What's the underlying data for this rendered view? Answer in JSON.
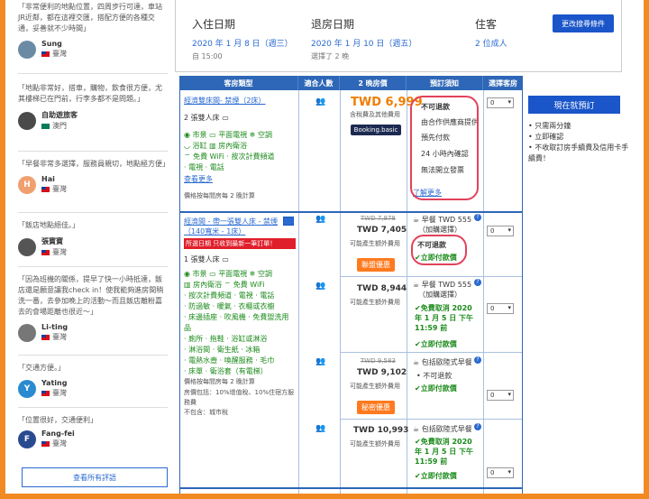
{
  "sidebar": {
    "reviews": [
      {
        "text": "「非常便利的地點位置，四周步行可達，車站JR近鄰，都在這裡交匯，搭配方便的各種交通，妥善就不少時間」",
        "name": "Sung",
        "country": "臺灣",
        "initial": "",
        "color": "#6b8ba4"
      },
      {
        "text": "「地點非常好，搭車，購物，飲食很方便，尤其樓梯已在門前，行李多都不是問題。」",
        "name": "自助遊旅客",
        "country": "澳門",
        "initial": "",
        "color": "#4a4a4a"
      },
      {
        "text": "「早餐非常多選擇，服務員親切，地點極方便」",
        "name": "Hai",
        "country": "臺灣",
        "initial": "H",
        "color": "#f0a070"
      },
      {
        "text": "「飯店地點絕佳。」",
        "name": "張寶寶",
        "country": "臺灣",
        "initial": "",
        "color": "#555"
      },
      {
        "text": "「因為班機的關係，提早了快一小時抵達，飯店還是願意讓我check in！使我能夠進房間稍洗一番，去參加晚上的活動～而且飯店離粉嘉去的會場距離也很近～」",
        "name": "Li-ting",
        "country": "臺灣",
        "initial": "",
        "color": "#777"
      },
      {
        "text": "「交通方便。」",
        "name": "Yating",
        "country": "臺灣",
        "initial": "Y",
        "color": "#2a8ad0"
      },
      {
        "text": "「位置很好，交通便利」",
        "name": "Fang-fei",
        "country": "臺灣",
        "initial": "F",
        "color": "#2a4a90"
      }
    ],
    "all_reviews_button": "查看所有評語"
  },
  "stay": {
    "checkin_label": "入住日期",
    "checkin_date": "2020 年 1 月 8 日（週三）",
    "checkin_time": "自 15:00",
    "checkout_label": "退房日期",
    "checkout_date": "2020 年 1 月 10 日（週五）",
    "checkout_nights": "選擇了 2 晚",
    "guests_label": "住客",
    "guests_value": "2 位成人",
    "change_button": "更改搜尋條件"
  },
  "table": {
    "headers": [
      "客房類型",
      "適合人數",
      "2 晚房價",
      "預訂須知",
      "選擇客房"
    ]
  },
  "room1": {
    "name": "經濟雙床間- 禁煙（2床）",
    "beds": "2 張雙人床",
    "amenities": [
      "市景",
      "平面電視",
      "空調",
      "浴缸",
      "房內衛浴",
      "免費 WiFi",
      "按次計費頻道",
      "電視",
      "電話"
    ],
    "more": "查看更多",
    "price_note": "價格按每間房每 2 晚計算",
    "price": "TWD 6,999",
    "price_sub": "含稅費及其他費用",
    "booking_logo": "Booking.basic",
    "policy": [
      "不可退款",
      "由合作供應商提供",
      "預先付款",
      "24 小時內確認",
      "無法開立發票"
    ],
    "learn_more": "了解更多",
    "qty": "0"
  },
  "room2": {
    "name": "經濟間 - 帶一張雙人床 - 禁煙（140寬米 - 1床）",
    "promo_banner": "所選日期 只收到最新一筆訂單！",
    "beds": "1 張雙人床",
    "amenities": [
      "市景",
      "平面電視",
      "空調",
      "房內衛浴",
      "免費 WiFi",
      "按次計費頻道",
      "電視",
      "電話",
      "防過敏",
      "暖氣",
      "衣櫃或衣櫥",
      "床邊插座",
      "吹風機",
      "免費盥洗用品",
      "廁所",
      "拖鞋",
      "浴缸或淋浴",
      "淋浴間",
      "衛生紙",
      "冰箱",
      "電熱水壺",
      "喚醒服務",
      "毛巾",
      "床單",
      "衛浴套（有電梯）"
    ],
    "price_note": "價格按每間房每 2 晚計算",
    "incl": "房價包括：10%增值稅、10%住宿方服務費",
    "excl": "不包含：城市稅",
    "rows": [
      {
        "old": "TWD 7,878",
        "price": "TWD 7,405",
        "sub": "可能產生額外費用",
        "tag": "聯盟優惠",
        "meal": "早餐 TWD 555",
        "meal_sub": "（加購選擇）",
        "p1": "不可退款",
        "p2": "立即付款價",
        "cancel": "",
        "qty": "0"
      },
      {
        "old": "",
        "price": "TWD 8,944",
        "sub": "可能產生額外費用",
        "tag": "",
        "meal": "早餐 TWD 555",
        "meal_sub": "（加購選擇）",
        "p1": "",
        "p2": "立即付款價",
        "cancel": "免費取消 2020 年 1 月 5 日 下午11:59 前",
        "qty": "0"
      },
      {
        "old": "TWD 9,583",
        "price": "TWD 9,102",
        "sub": "可能產生額外費用",
        "tag": "秘密優惠",
        "meal": "包括歐陸式早餐",
        "meal_sub": "",
        "p1": "不可退款",
        "p2": "立即付款價",
        "cancel": "",
        "qty": "0"
      },
      {
        "old": "",
        "price": "TWD 10,993",
        "sub": "可能產生額外費用",
        "tag": "",
        "meal": "包括歐陸式早餐",
        "meal_sub": "",
        "p1": "",
        "p2": "立即付款價",
        "cancel": "免費取消 2020 年 1 月 5 日 下午11:59 前",
        "qty": "0"
      }
    ]
  },
  "booking": {
    "button": "現在就預訂",
    "bullets": [
      "只需兩分鐘",
      "立即確認",
      "不收取訂房手續費及信用卡手續費！"
    ]
  }
}
